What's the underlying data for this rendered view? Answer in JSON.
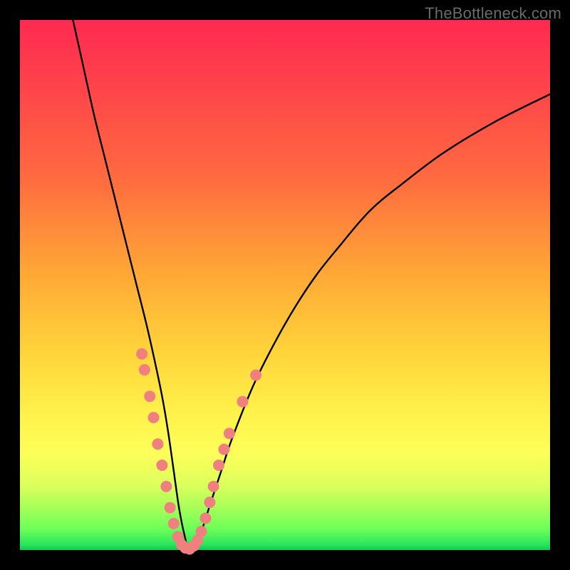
{
  "watermark": "TheBottleneck.com",
  "chart_data": {
    "type": "line",
    "title": "",
    "xlabel": "",
    "ylabel": "",
    "xlim": [
      0,
      100
    ],
    "ylim": [
      0,
      100
    ],
    "grid": false,
    "curve": {
      "name": "bottleneck-curve",
      "color": "#000000",
      "x": [
        10,
        12,
        14,
        16,
        18,
        20,
        22,
        24,
        26,
        27,
        28,
        29,
        30,
        31,
        32,
        34,
        36,
        38,
        40,
        44,
        48,
        52,
        56,
        60,
        66,
        72,
        80,
        90,
        100
      ],
      "y": [
        100,
        91,
        82,
        74,
        66,
        58,
        50,
        42,
        33,
        28,
        22,
        15,
        8,
        3,
        0,
        3,
        9,
        15,
        21,
        31,
        39,
        46,
        52,
        57,
        64,
        69,
        75,
        81,
        86
      ]
    },
    "markers": {
      "name": "highlight-points",
      "color": "#f08080",
      "radius": 8,
      "points": [
        {
          "x": 23.0,
          "y": 37
        },
        {
          "x": 23.5,
          "y": 34
        },
        {
          "x": 24.5,
          "y": 29
        },
        {
          "x": 25.2,
          "y": 25
        },
        {
          "x": 26.0,
          "y": 20
        },
        {
          "x": 26.8,
          "y": 16
        },
        {
          "x": 27.6,
          "y": 12
        },
        {
          "x": 28.3,
          "y": 8
        },
        {
          "x": 29.0,
          "y": 5
        },
        {
          "x": 29.8,
          "y": 2.5
        },
        {
          "x": 30.5,
          "y": 1.0
        },
        {
          "x": 31.2,
          "y": 0.4
        },
        {
          "x": 32.0,
          "y": 0.2
        },
        {
          "x": 32.8,
          "y": 0.8
        },
        {
          "x": 33.5,
          "y": 1.8
        },
        {
          "x": 34.2,
          "y": 3.5
        },
        {
          "x": 35.0,
          "y": 6
        },
        {
          "x": 35.8,
          "y": 9
        },
        {
          "x": 36.5,
          "y": 12
        },
        {
          "x": 37.5,
          "y": 16
        },
        {
          "x": 38.5,
          "y": 19
        },
        {
          "x": 39.5,
          "y": 22
        },
        {
          "x": 42.0,
          "y": 28
        },
        {
          "x": 44.5,
          "y": 33
        }
      ]
    }
  }
}
